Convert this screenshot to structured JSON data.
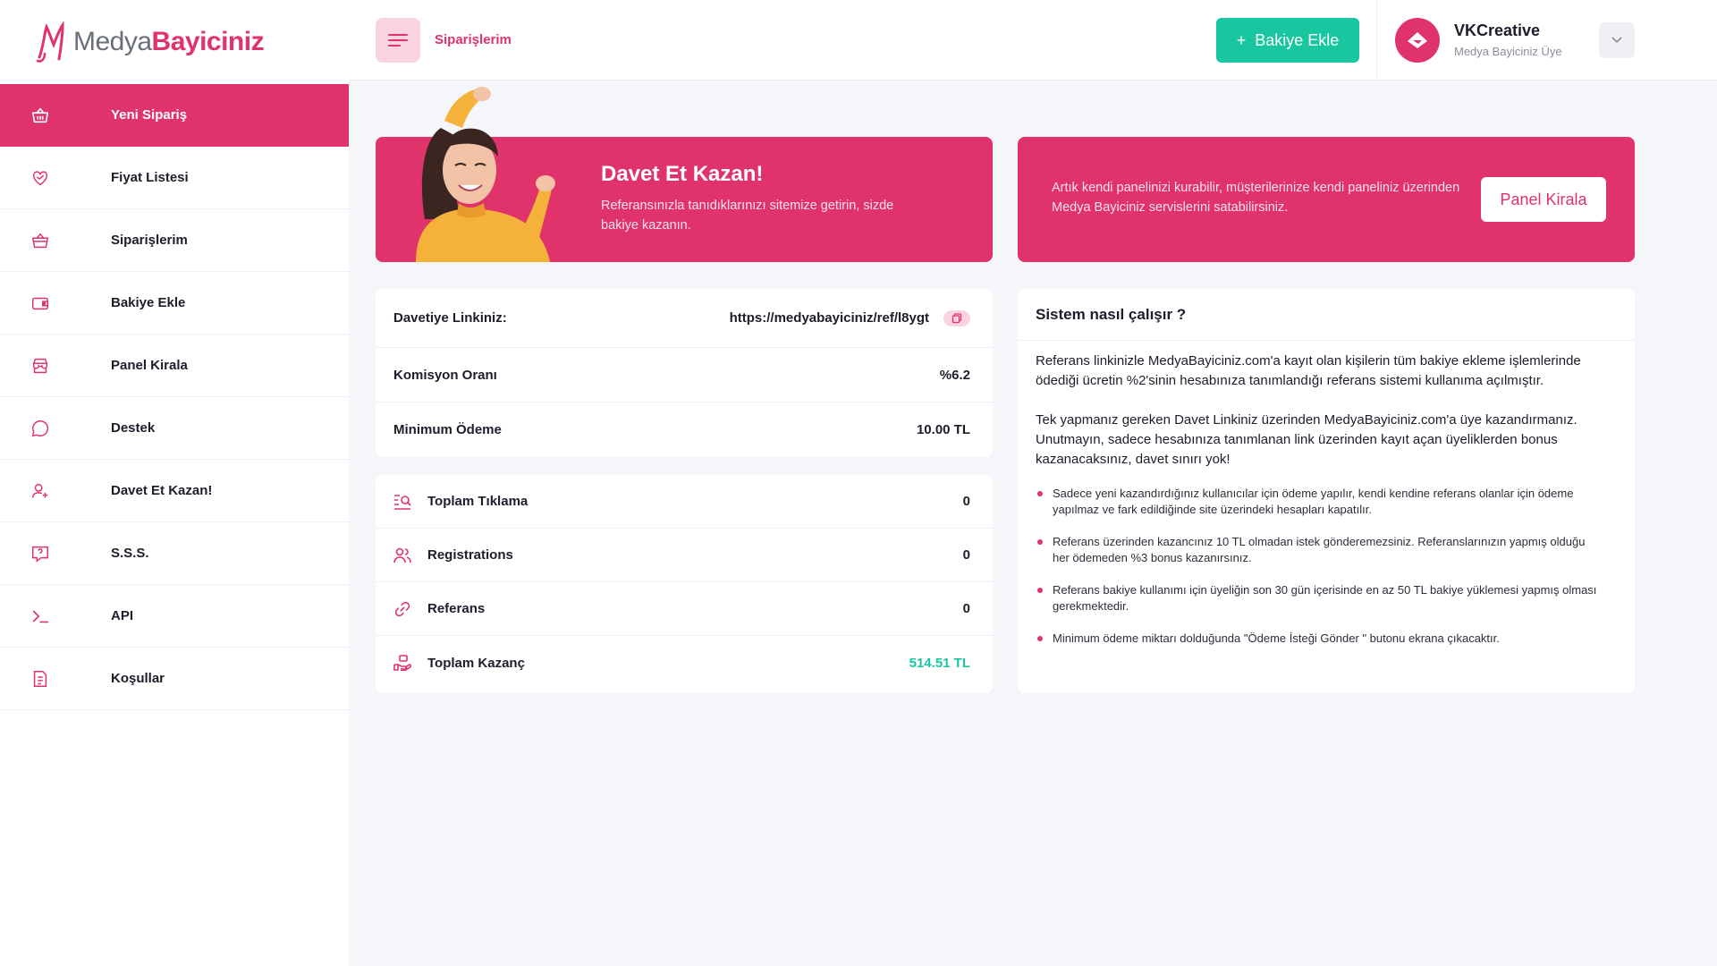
{
  "brand": {
    "name_part1": "Medya",
    "name_part2": "Bayiciniz",
    "accent": "#e0326b",
    "green": "#18c79f"
  },
  "sidebar": {
    "items": [
      {
        "label": "Yeni Sipariş",
        "icon": "basket-icon",
        "active": true
      },
      {
        "label": "Fiyat Listesi",
        "icon": "heart-tag-icon"
      },
      {
        "label": "Siparişlerim",
        "icon": "basket-icon"
      },
      {
        "label": "Bakiye Ekle",
        "icon": "wallet-icon"
      },
      {
        "label": "Panel Kirala",
        "icon": "store-icon"
      },
      {
        "label": "Destek",
        "icon": "chat-icon"
      },
      {
        "label": "Davet Et Kazan!",
        "icon": "user-add-icon"
      },
      {
        "label": "S.S.S.",
        "icon": "question-icon"
      },
      {
        "label": "API",
        "icon": "terminal-icon"
      },
      {
        "label": "Koşullar",
        "icon": "document-icon"
      }
    ]
  },
  "header": {
    "title": "Siparişlerim",
    "add_balance_label": "Bakiye Ekle",
    "user_name": "VKCreative",
    "user_role": "Medya Bayiciniz Üye"
  },
  "banner_invite": {
    "title": "Davet Et Kazan!",
    "text": "Referansınızla tanıdıklarınızı sitemize getirin, sizde bakiye kazanın."
  },
  "banner_panel": {
    "text": "Artık kendi panelinizi kurabilir, müşterilerinize kendi paneliniz üzerinden Medya Bayiciniz servislerini satabilirsiniz.",
    "button_label": "Panel Kirala"
  },
  "invite_info": {
    "link_label": "Davetiye Linkiniz:",
    "link_value": "https://medyabayiciniz/ref/l8ygt",
    "commission_label": "Komisyon Oranı",
    "commission_value": "%6.2",
    "min_payment_label": "Minimum Ödeme",
    "min_payment_value": "10.00 TL"
  },
  "stats": [
    {
      "label": "Toplam Tıklama",
      "value": "0",
      "icon": "search-list-icon"
    },
    {
      "label": "Registrations",
      "value": "0",
      "icon": "users-icon"
    },
    {
      "label": "Referans",
      "value": "0",
      "icon": "link-icon"
    },
    {
      "label": "Toplam Kazanç",
      "value": "514.51 TL",
      "icon": "hand-money-icon"
    }
  ],
  "how_it_works": {
    "title": "Sistem nasıl çalışır ?",
    "paragraph1": "Referans linkinizle MedyaBayiciniz.com'a kayıt olan kişilerin tüm bakiye ekleme işlemlerinde ödediği ücretin %2'sinin hesabınıza tanımlandığı referans sistemi kullanıma açılmıştır.",
    "paragraph2": "Tek yapmanız gereken Davet Linkiniz üzerinden MedyaBayiciniz.com'a üye kazandırmanız. Unutmayın, sadece hesabınıza tanımlanan link üzerinden kayıt açan üyeliklerden bonus kazanacaksınız, davet sınırı yok!",
    "bullets": [
      "Sadece yeni kazandırdığınız kullanıcılar için ödeme yapılır, kendi kendine referans olanlar için ödeme yapılmaz ve fark edildiğinde site üzerindeki hesapları kapatılır.",
      "Referans üzerinden kazancınız 10 TL olmadan istek gönderemezsiniz. Referanslarınızın yapmış olduğu her ödemeden %3 bonus kazanırsınız.",
      "Referans bakiye kullanımı için üyeliğin son 30 gün içerisinde en az 50 TL bakiye yüklemesi yapmış olması gerekmektedir.",
      "Minimum ödeme miktarı dolduğunda \"Ödeme İsteği Gönder \" butonu ekrana çıkacaktır."
    ]
  }
}
